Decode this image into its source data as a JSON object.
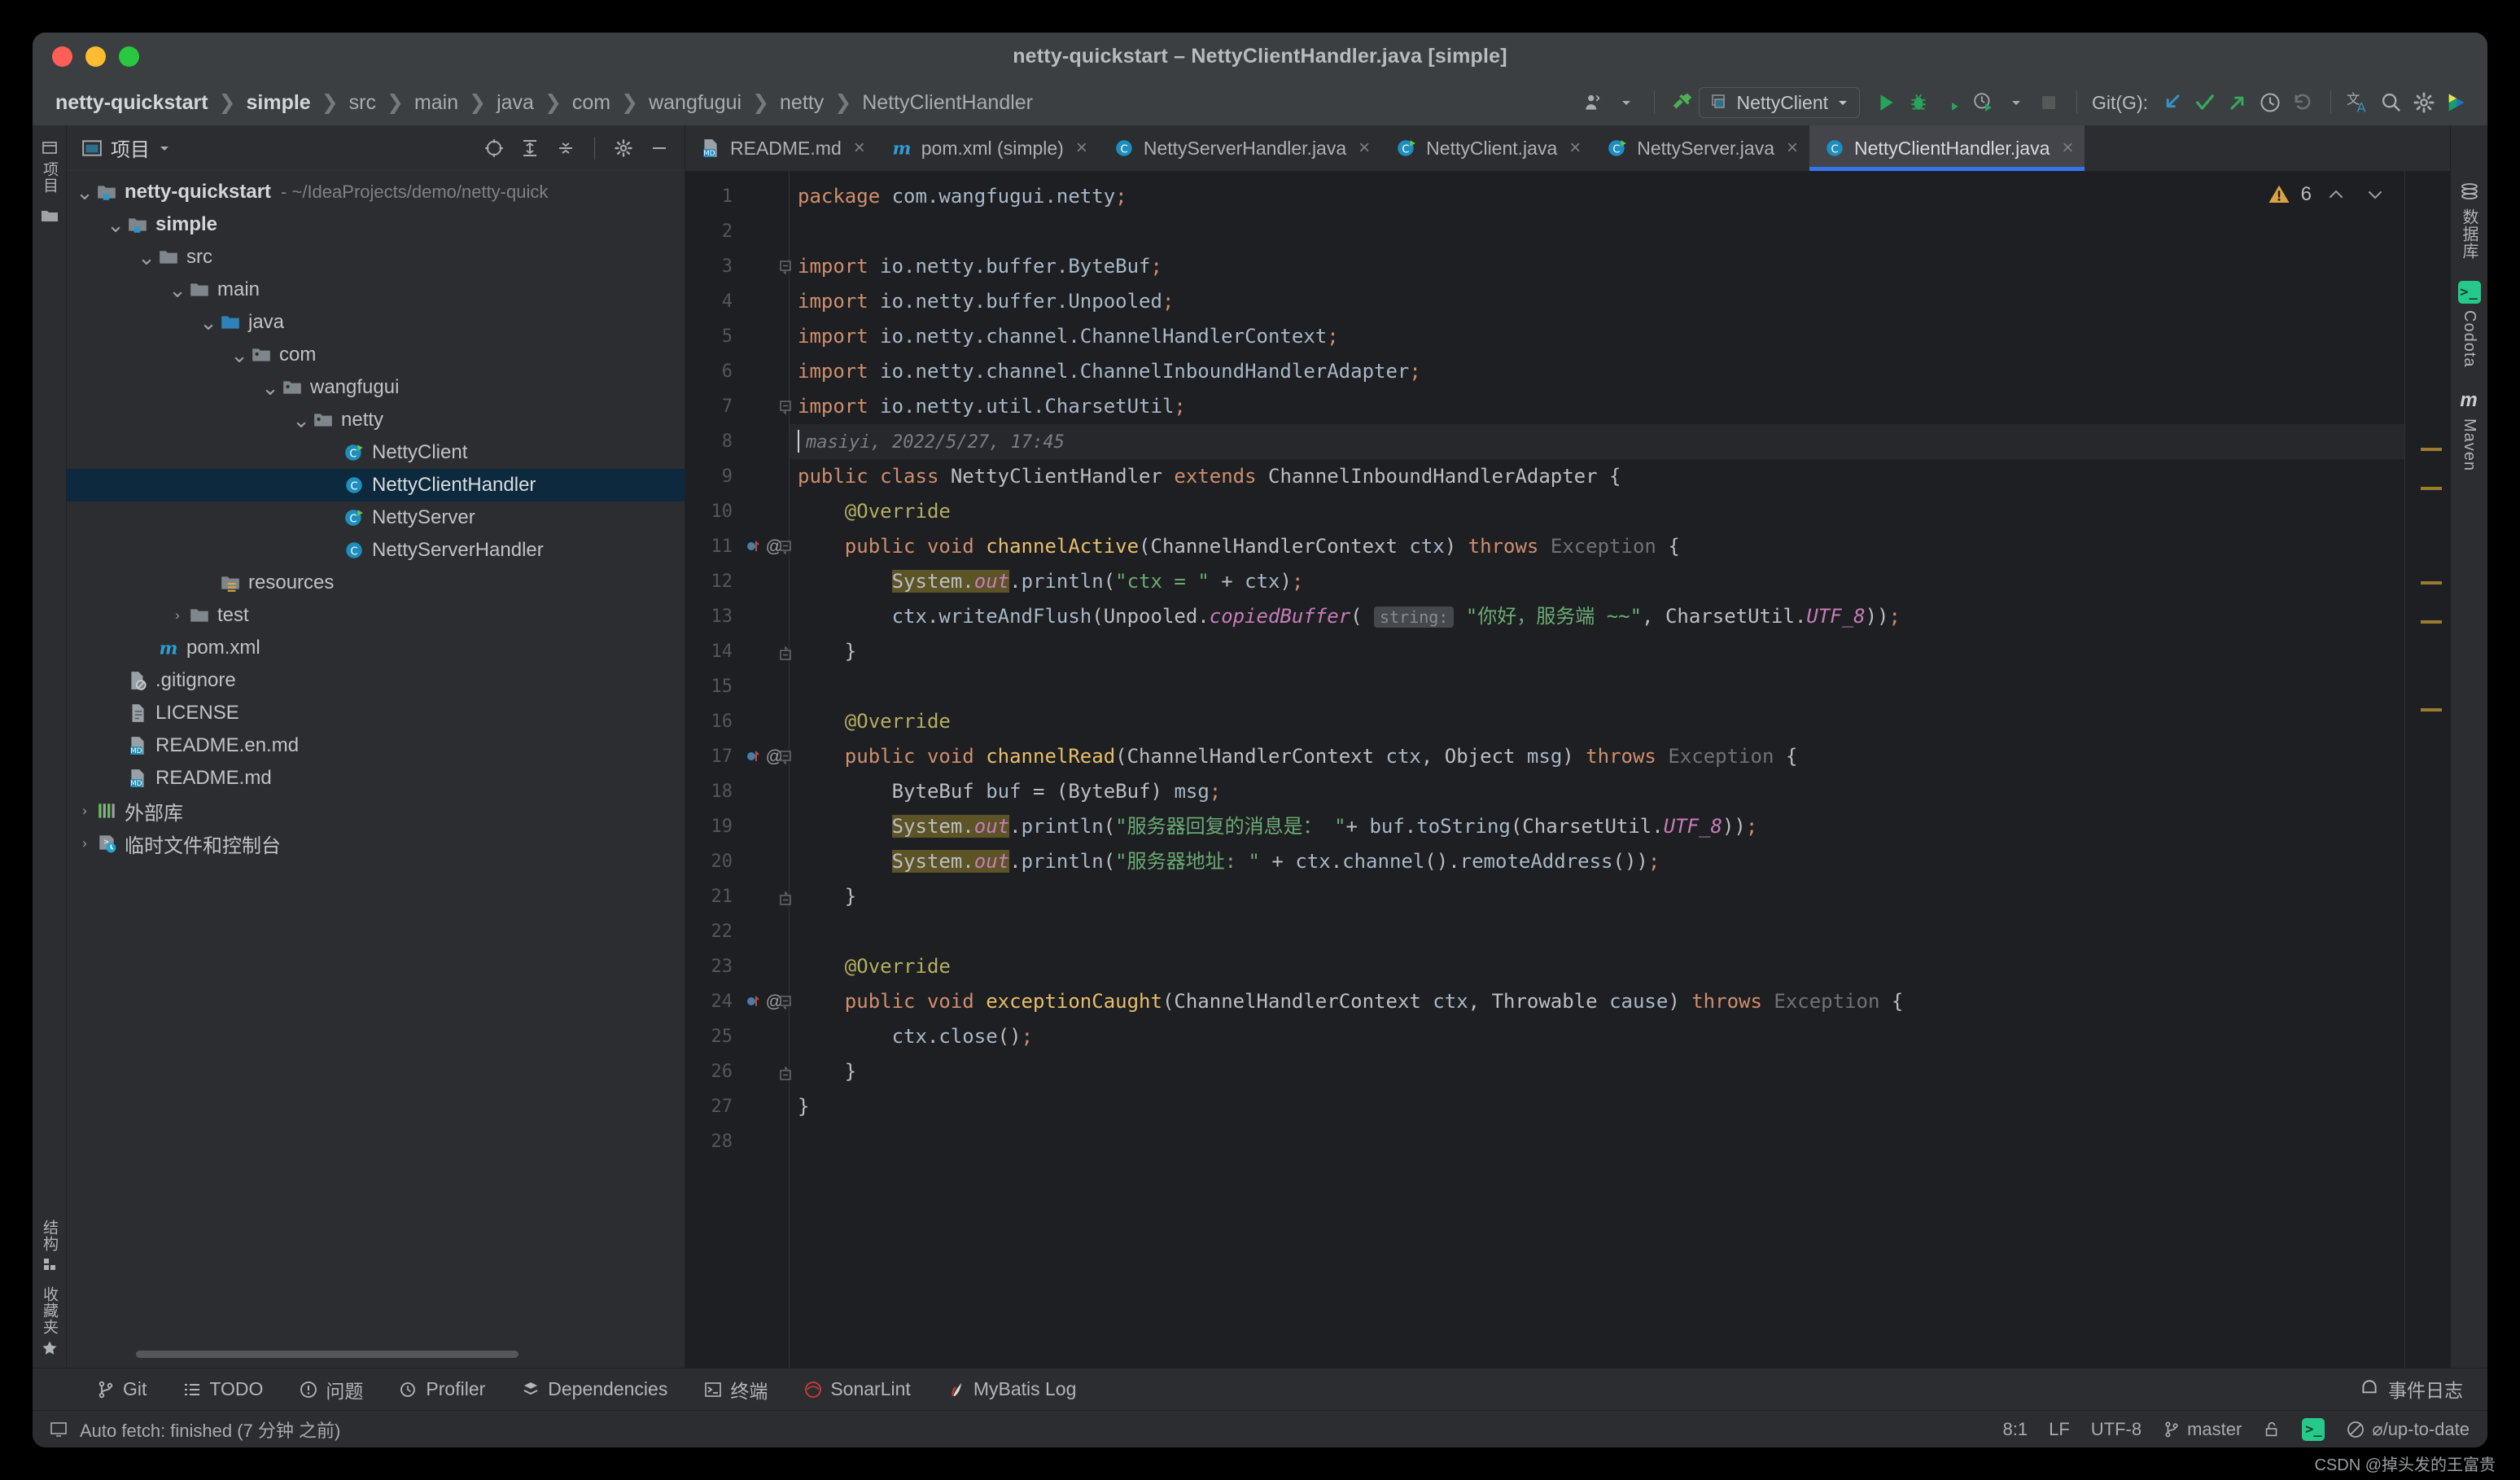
{
  "window": {
    "title": "netty-quickstart – NettyClientHandler.java [simple]"
  },
  "breadcrumb": [
    {
      "label": "netty-quickstart",
      "bold": true
    },
    {
      "label": "simple",
      "bold": true
    },
    {
      "label": "src",
      "bold": false
    },
    {
      "label": "main",
      "bold": false
    },
    {
      "label": "java",
      "bold": false
    },
    {
      "label": "com",
      "bold": false
    },
    {
      "label": "wangfugui",
      "bold": false
    },
    {
      "label": "netty",
      "bold": false
    },
    {
      "label": "NettyClientHandler",
      "bold": false
    }
  ],
  "toolbar": {
    "run_config": "NettyClient",
    "git_label": "Git(G):",
    "icons": [
      "user-icon",
      "hammer-icon",
      "run-icon",
      "debug-icon",
      "coverage-icon",
      "profile-icon",
      "stop-icon",
      "git-update-icon",
      "git-commit-icon",
      "git-push-icon",
      "history-icon",
      "rollback-icon",
      "translate-icon",
      "search-icon",
      "settings-icon",
      "ide-plugin-icon"
    ]
  },
  "project_panel": {
    "title": "项目",
    "header_icons": [
      "locate-icon",
      "expand-all-icon",
      "collapse-all-icon",
      "settings-icon",
      "minimize-icon"
    ],
    "tree": [
      {
        "depth": 0,
        "arrow": "v",
        "icon": "module-folder",
        "label": "netty-quickstart",
        "bold": true,
        "sub": "- ~/IdeaProjects/demo/netty-quick",
        "selected": false
      },
      {
        "depth": 1,
        "arrow": "v",
        "icon": "module-folder",
        "label": "simple",
        "bold": true,
        "sub": "",
        "selected": false
      },
      {
        "depth": 2,
        "arrow": "v",
        "icon": "folder",
        "label": "src",
        "bold": false,
        "sub": "",
        "selected": false
      },
      {
        "depth": 3,
        "arrow": "v",
        "icon": "folder",
        "label": "main",
        "bold": false,
        "sub": "",
        "selected": false
      },
      {
        "depth": 4,
        "arrow": "v",
        "icon": "source-folder",
        "label": "java",
        "bold": false,
        "sub": "",
        "selected": false
      },
      {
        "depth": 5,
        "arrow": "v",
        "icon": "package",
        "label": "com",
        "bold": false,
        "sub": "",
        "selected": false
      },
      {
        "depth": 6,
        "arrow": "v",
        "icon": "package",
        "label": "wangfugui",
        "bold": false,
        "sub": "",
        "selected": false
      },
      {
        "depth": 7,
        "arrow": "v",
        "icon": "package",
        "label": "netty",
        "bold": false,
        "sub": "",
        "selected": false
      },
      {
        "depth": 8,
        "arrow": "",
        "icon": "java-class-run",
        "label": "NettyClient",
        "bold": false,
        "sub": "",
        "selected": false
      },
      {
        "depth": 8,
        "arrow": "",
        "icon": "java-class",
        "label": "NettyClientHandler",
        "bold": false,
        "sub": "",
        "selected": true
      },
      {
        "depth": 8,
        "arrow": "",
        "icon": "java-class-run",
        "label": "NettyServer",
        "bold": false,
        "sub": "",
        "selected": false
      },
      {
        "depth": 8,
        "arrow": "",
        "icon": "java-class",
        "label": "NettyServerHandler",
        "bold": false,
        "sub": "",
        "selected": false
      },
      {
        "depth": 4,
        "arrow": "",
        "icon": "resource-folder",
        "label": "resources",
        "bold": false,
        "sub": "",
        "selected": false
      },
      {
        "depth": 3,
        "arrow": ">",
        "icon": "folder",
        "label": "test",
        "bold": false,
        "sub": "",
        "selected": false
      },
      {
        "depth": 2,
        "arrow": "",
        "icon": "maven-file",
        "label": "pom.xml",
        "bold": false,
        "sub": "",
        "selected": false
      },
      {
        "depth": 1,
        "arrow": "",
        "icon": "gitignore-file",
        "label": ".gitignore",
        "bold": false,
        "sub": "",
        "selected": false
      },
      {
        "depth": 1,
        "arrow": "",
        "icon": "text-file",
        "label": "LICENSE",
        "bold": false,
        "sub": "",
        "selected": false
      },
      {
        "depth": 1,
        "arrow": "",
        "icon": "md-file",
        "label": "README.en.md",
        "bold": false,
        "sub": "",
        "selected": false
      },
      {
        "depth": 1,
        "arrow": "",
        "icon": "md-file",
        "label": "README.md",
        "bold": false,
        "sub": "",
        "selected": false
      },
      {
        "depth": 0,
        "arrow": ">",
        "icon": "library-icon",
        "label": "外部库",
        "bold": false,
        "sub": "",
        "selected": false
      },
      {
        "depth": 0,
        "arrow": ">",
        "icon": "scratch-icon",
        "label": "临时文件和控制台",
        "bold": false,
        "sub": "",
        "selected": false
      }
    ]
  },
  "left_rail": {
    "top": [
      "项目"
    ],
    "bottom": [
      "结构",
      "收藏夹"
    ]
  },
  "right_rail": [
    "数据库",
    "Codota",
    "Maven"
  ],
  "tabs": [
    {
      "label": "README.md",
      "icon": "md-file",
      "active": false
    },
    {
      "label": "pom.xml (simple)",
      "icon": "maven-file",
      "active": false
    },
    {
      "label": "NettyServerHandler.java",
      "icon": "java-class",
      "active": false
    },
    {
      "label": "NettyClient.java",
      "icon": "java-class-run",
      "active": false
    },
    {
      "label": "NettyServer.java",
      "icon": "java-class-run",
      "active": false
    },
    {
      "label": "NettyClientHandler.java",
      "icon": "java-class",
      "active": true
    }
  ],
  "inspection": {
    "warning_count": "6",
    "up_arrow": "⌃",
    "down_arrow": "⌄"
  },
  "code": {
    "lines": [
      {
        "n": "1",
        "gutter": {
          "run": false,
          "at": false,
          "fold": ""
        }
      },
      {
        "n": "2",
        "gutter": {
          "run": false,
          "at": false,
          "fold": ""
        }
      },
      {
        "n": "3",
        "gutter": {
          "run": false,
          "at": false,
          "fold": "-"
        }
      },
      {
        "n": "4",
        "gutter": {
          "run": false,
          "at": false,
          "fold": ""
        }
      },
      {
        "n": "5",
        "gutter": {
          "run": false,
          "at": false,
          "fold": ""
        }
      },
      {
        "n": "6",
        "gutter": {
          "run": false,
          "at": false,
          "fold": ""
        }
      },
      {
        "n": "7",
        "gutter": {
          "run": false,
          "at": false,
          "fold": "-"
        }
      },
      {
        "n": "8",
        "gutter": {
          "run": false,
          "at": false,
          "fold": ""
        }
      },
      {
        "n": "9",
        "gutter": {
          "run": false,
          "at": false,
          "fold": ""
        }
      },
      {
        "n": "10",
        "gutter": {
          "run": false,
          "at": false,
          "fold": ""
        }
      },
      {
        "n": "11",
        "gutter": {
          "run": true,
          "at": true,
          "fold": "-"
        }
      },
      {
        "n": "12",
        "gutter": {
          "run": false,
          "at": false,
          "fold": ""
        }
      },
      {
        "n": "13",
        "gutter": {
          "run": false,
          "at": false,
          "fold": ""
        }
      },
      {
        "n": "14",
        "gutter": {
          "run": false,
          "at": false,
          "fold": "^"
        }
      },
      {
        "n": "15",
        "gutter": {
          "run": false,
          "at": false,
          "fold": ""
        }
      },
      {
        "n": "16",
        "gutter": {
          "run": false,
          "at": false,
          "fold": ""
        }
      },
      {
        "n": "17",
        "gutter": {
          "run": true,
          "at": true,
          "fold": "-"
        }
      },
      {
        "n": "18",
        "gutter": {
          "run": false,
          "at": false,
          "fold": ""
        }
      },
      {
        "n": "19",
        "gutter": {
          "run": false,
          "at": false,
          "fold": ""
        }
      },
      {
        "n": "20",
        "gutter": {
          "run": false,
          "at": false,
          "fold": ""
        }
      },
      {
        "n": "21",
        "gutter": {
          "run": false,
          "at": false,
          "fold": "^"
        }
      },
      {
        "n": "22",
        "gutter": {
          "run": false,
          "at": false,
          "fold": ""
        }
      },
      {
        "n": "23",
        "gutter": {
          "run": false,
          "at": false,
          "fold": ""
        }
      },
      {
        "n": "24",
        "gutter": {
          "run": true,
          "at": true,
          "fold": "-"
        }
      },
      {
        "n": "25",
        "gutter": {
          "run": false,
          "at": false,
          "fold": ""
        }
      },
      {
        "n": "26",
        "gutter": {
          "run": false,
          "at": false,
          "fold": "^"
        }
      },
      {
        "n": "27",
        "gutter": {
          "run": false,
          "at": false,
          "fold": ""
        }
      },
      {
        "n": "28",
        "gutter": {
          "run": false,
          "at": false,
          "fold": ""
        }
      }
    ],
    "text": {
      "l1": "package com.wangfugui.netty;",
      "l3": "import io.netty.buffer.ByteBuf;",
      "l4": "import io.netty.buffer.Unpooled;",
      "l5": "import io.netty.channel.ChannelHandlerContext;",
      "l6": "import io.netty.channel.ChannelInboundHandlerAdapter;",
      "l7": "import io.netty.util.CharsetUtil;",
      "l8_annotation": "masiyi, 2022/5/27, 17:45",
      "l9": "public class NettyClientHandler extends ChannelInboundHandlerAdapter {",
      "l10": "@Override",
      "l11": "public void channelActive(ChannelHandlerContext ctx) throws Exception {",
      "l12": "System.out.println(\"ctx = \" + ctx);",
      "l13": "ctx.writeAndFlush(Unpooled.copiedBuffer( string: \"你好，服务端 ~~\", CharsetUtil.UTF_8));",
      "l13_string": "\"你好，服务端 ~~\"",
      "l13_inlay": "string:",
      "l16": "@Override",
      "l17": "public void channelRead(ChannelHandlerContext ctx, Object msg) throws Exception {",
      "l18": "ByteBuf buf = (ByteBuf) msg;",
      "l19": "System.out.println(\"服务器回复的消息是： \"+ buf.toString(CharsetUtil.UTF_8));",
      "l19_string": "\"服务器回复的消息是： \"",
      "l20": "System.out.println(\"服务器地址: \" + ctx.channel().remoteAddress());",
      "l20_string": "\"服务器地址: \"",
      "l23": "@Override",
      "l24": "public void exceptionCaught(ChannelHandlerContext ctx, Throwable cause) throws Exception {",
      "l25": "ctx.close();"
    }
  },
  "tool_windows": [
    {
      "label": "Git",
      "icon": "git-icon"
    },
    {
      "label": "TODO",
      "icon": "todo-icon"
    },
    {
      "label": "问题",
      "icon": "problems-icon"
    },
    {
      "label": "Profiler",
      "icon": "profiler-icon"
    },
    {
      "label": "Dependencies",
      "icon": "dependencies-icon"
    },
    {
      "label": "终端",
      "icon": "terminal-icon"
    },
    {
      "label": "SonarLint",
      "icon": "sonarlint-icon"
    },
    {
      "label": "MyBatis Log",
      "icon": "mybatis-icon"
    }
  ],
  "event_log": {
    "label": "事件日志",
    "icon": "bell-icon"
  },
  "status_bar": {
    "message": "Auto fetch: finished (7 分钟 之前)",
    "message_icon": "console-icon",
    "caret": "8:1",
    "line_sep": "LF",
    "encoding": "UTF-8",
    "branch": "master",
    "branch_icon": "git-branch-icon",
    "lock_icon": "unlock-icon",
    "codota_icon": "codota-icon",
    "inspection_status": "⌀/up-to-date",
    "inspection_icon": "no-highlight-icon"
  },
  "watermark": "CSDN @掉头发的王富贵",
  "colors": {
    "accent_blue": "#3574f0",
    "keyword_orange": "#cf8e6d",
    "string_green": "#6aab73",
    "annotation_yellow": "#b3ae60",
    "static_purple": "#c77dbb",
    "selection_blue": "#0d293e",
    "warning_yellow": "#d9a343"
  }
}
